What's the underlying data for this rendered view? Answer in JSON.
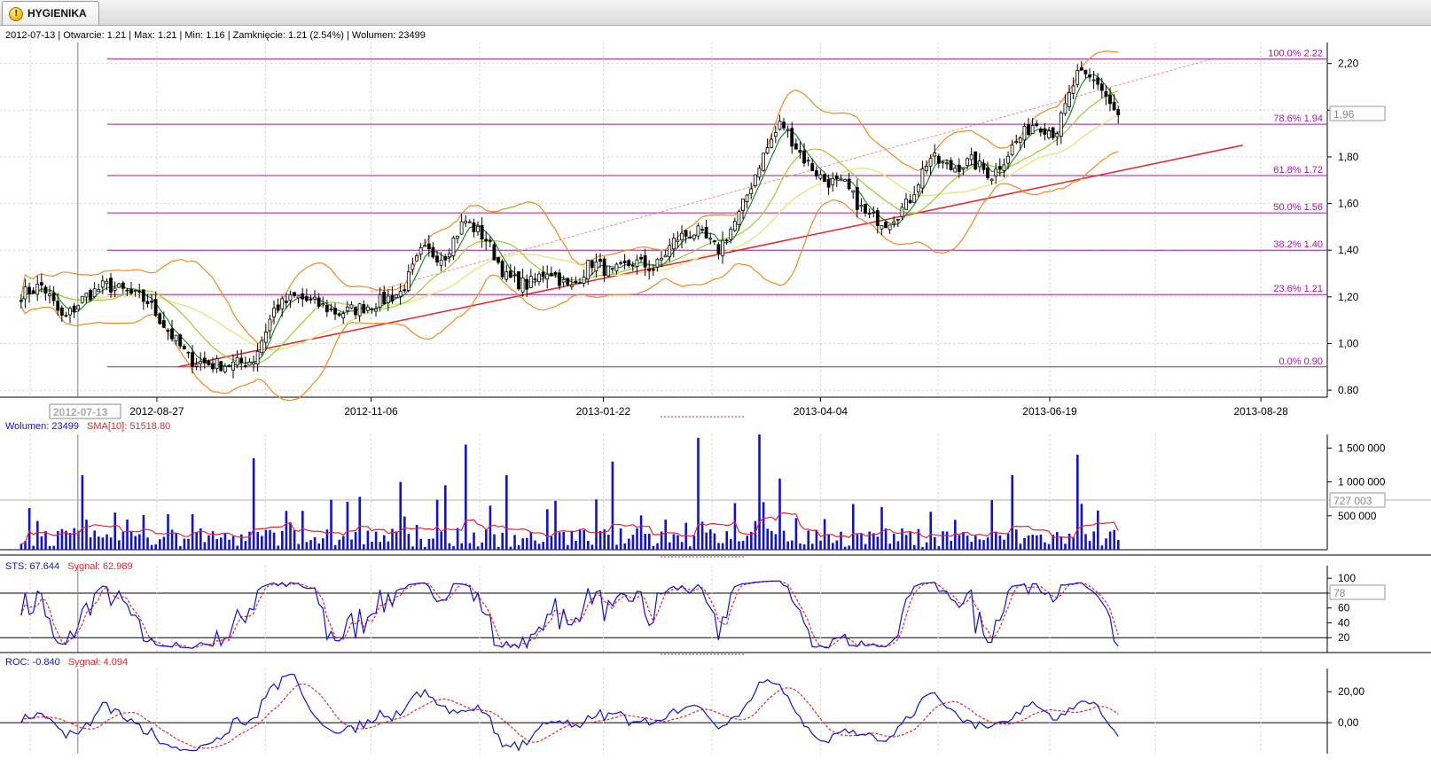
{
  "tab": {
    "label": "HYGIENIKA",
    "icon": "warning-icon",
    "icon_glyph": "!"
  },
  "info_bar": "2012-07-13 | Otwarcie: 1.21 | Max: 1.21 | Min: 1.16 | Zamknięcie: 1.21 (2.54%)  | Wolumen: 23499",
  "crosshair": {
    "date": "2012-07-13",
    "price_marker": "1,96",
    "volume_marker": "727 003",
    "sts_marker": "78"
  },
  "colors": {
    "background": "#ffffff",
    "grid": "#d0d0d0",
    "fib": "#a01aa0",
    "trend": "#e8232a",
    "bollinger": "#f08a1c",
    "ma_fast": "#1f8a1f",
    "ma_mid": "#9acd32",
    "ma_slow": "#e6e88a",
    "volume": "#1010d8",
    "signal": "#e8232a",
    "main_line": "#1010d8"
  },
  "chart_data": [
    {
      "type": "candlestick",
      "title": "HYGIENIKA",
      "x_tick_labels": [
        "2012-08-27",
        "2012-11-06",
        "2013-01-22",
        "2013-04-04",
        "2013-06-19",
        "2013-08-28"
      ],
      "y_tick_labels": [
        "0.80",
        "1,00",
        "1,20",
        "1,40",
        "1,60",
        "1,80",
        "2,00",
        "2,20"
      ],
      "y_ticks": [
        0.8,
        1.0,
        1.2,
        1.4,
        1.6,
        1.8,
        2.0,
        2.2
      ],
      "ylim": [
        0.77,
        2.29
      ],
      "fibonacci_levels": [
        {
          "label": "100.0% 2.22",
          "value": 2.22
        },
        {
          "label": "78.6% 1.94",
          "value": 1.94
        },
        {
          "label": "61.8% 1.72",
          "value": 1.72
        },
        {
          "label": "50.0% 1.56",
          "value": 1.56
        },
        {
          "label": "38.2% 1.40",
          "value": 1.4
        },
        {
          "label": "23.6% 1.21",
          "value": 1.21
        },
        {
          "label": "0.0% 0.90",
          "value": 0.9
        }
      ],
      "trend_line": {
        "from": {
          "x": "2012-09-03",
          "y": 0.9
        },
        "to": {
          "x": "2013-08-22",
          "y": 1.85
        }
      },
      "trend_line_dashed": {
        "from": {
          "x": "2012-11-06",
          "y": 1.22
        },
        "to": {
          "x": "2013-08-12",
          "y": 2.22
        }
      },
      "close_points": [
        {
          "x": "2012-07-13",
          "y": 1.21
        },
        {
          "x": "2012-07-20",
          "y": 1.25
        },
        {
          "x": "2012-07-27",
          "y": 1.1
        },
        {
          "x": "2012-08-03",
          "y": 1.2
        },
        {
          "x": "2012-08-10",
          "y": 1.25
        },
        {
          "x": "2012-08-17",
          "y": 1.22
        },
        {
          "x": "2012-08-24",
          "y": 1.18
        },
        {
          "x": "2012-08-31",
          "y": 1.05
        },
        {
          "x": "2012-09-07",
          "y": 0.93
        },
        {
          "x": "2012-09-14",
          "y": 0.91
        },
        {
          "x": "2012-09-21",
          "y": 0.91
        },
        {
          "x": "2012-09-28",
          "y": 0.93
        },
        {
          "x": "2012-10-05",
          "y": 1.15
        },
        {
          "x": "2012-10-12",
          "y": 1.2
        },
        {
          "x": "2012-10-19",
          "y": 1.17
        },
        {
          "x": "2012-10-26",
          "y": 1.13
        },
        {
          "x": "2012-11-02",
          "y": 1.15
        },
        {
          "x": "2012-11-09",
          "y": 1.18
        },
        {
          "x": "2012-11-16",
          "y": 1.22
        },
        {
          "x": "2012-11-23",
          "y": 1.4
        },
        {
          "x": "2012-11-30",
          "y": 1.37
        },
        {
          "x": "2012-12-07",
          "y": 1.53
        },
        {
          "x": "2012-12-14",
          "y": 1.45
        },
        {
          "x": "2012-12-21",
          "y": 1.28
        },
        {
          "x": "2012-12-28",
          "y": 1.25
        },
        {
          "x": "2013-01-04",
          "y": 1.32
        },
        {
          "x": "2013-01-11",
          "y": 1.23
        },
        {
          "x": "2013-01-18",
          "y": 1.35
        },
        {
          "x": "2013-01-25",
          "y": 1.3
        },
        {
          "x": "2013-02-01",
          "y": 1.35
        },
        {
          "x": "2013-02-08",
          "y": 1.32
        },
        {
          "x": "2013-02-15",
          "y": 1.45
        },
        {
          "x": "2013-02-22",
          "y": 1.48
        },
        {
          "x": "2013-03-01",
          "y": 1.4
        },
        {
          "x": "2013-03-08",
          "y": 1.55
        },
        {
          "x": "2013-03-15",
          "y": 1.78
        },
        {
          "x": "2013-03-22",
          "y": 1.95
        },
        {
          "x": "2013-03-29",
          "y": 1.8
        },
        {
          "x": "2013-04-05",
          "y": 1.7
        },
        {
          "x": "2013-04-12",
          "y": 1.68
        },
        {
          "x": "2013-04-19",
          "y": 1.55
        },
        {
          "x": "2013-04-26",
          "y": 1.52
        },
        {
          "x": "2013-05-03",
          "y": 1.6
        },
        {
          "x": "2013-05-10",
          "y": 1.8
        },
        {
          "x": "2013-05-17",
          "y": 1.75
        },
        {
          "x": "2013-05-24",
          "y": 1.78
        },
        {
          "x": "2013-05-31",
          "y": 1.72
        },
        {
          "x": "2013-06-07",
          "y": 1.85
        },
        {
          "x": "2013-06-14",
          "y": 1.95
        },
        {
          "x": "2013-06-21",
          "y": 1.9
        },
        {
          "x": "2013-06-28",
          "y": 2.15
        },
        {
          "x": "2013-07-05",
          "y": 2.12
        },
        {
          "x": "2013-07-12",
          "y": 1.96
        }
      ]
    },
    {
      "type": "bar",
      "title": "Wolumen",
      "series": [
        {
          "name": "Wolumen: 23499"
        },
        {
          "name": "SMA[10]: 51518.80"
        }
      ],
      "y_tick_labels": [
        "500 000",
        "1 000 000",
        "1 500 000"
      ],
      "y_ticks": [
        500000,
        1000000,
        1500000
      ],
      "ylim": [
        0,
        1700000
      ],
      "large_bars": [
        {
          "x": "2012-08-03",
          "y": 1100000
        },
        {
          "x": "2012-09-28",
          "y": 1350000
        },
        {
          "x": "2012-11-02",
          "y": 780000
        },
        {
          "x": "2012-11-16",
          "y": 1000000
        },
        {
          "x": "2012-11-30",
          "y": 950000
        },
        {
          "x": "2012-12-07",
          "y": 1550000
        },
        {
          "x": "2012-12-21",
          "y": 1100000
        },
        {
          "x": "2013-01-25",
          "y": 1300000
        },
        {
          "x": "2013-02-22",
          "y": 1650000
        },
        {
          "x": "2013-03-15",
          "y": 1700000
        },
        {
          "x": "2013-03-22",
          "y": 1050000
        },
        {
          "x": "2013-05-31",
          "y": 730000
        },
        {
          "x": "2013-06-07",
          "y": 1100000
        },
        {
          "x": "2013-06-28",
          "y": 1400000
        }
      ]
    },
    {
      "type": "line",
      "title": "STS",
      "series": [
        {
          "name": "STS: 67.644"
        },
        {
          "name": "Sygnał: 62.989"
        }
      ],
      "y_tick_labels": [
        "20",
        "40",
        "60",
        "80",
        "100"
      ],
      "y_ticks": [
        20,
        40,
        60,
        80,
        100
      ],
      "ylim": [
        0,
        105
      ],
      "reference_lines": [
        20,
        80
      ]
    },
    {
      "type": "line",
      "title": "ROC",
      "series": [
        {
          "name": "ROC: -0.840"
        },
        {
          "name": "Sygnał: 4.094"
        }
      ],
      "y_tick_labels": [
        "0,00",
        "20,00"
      ],
      "y_ticks": [
        0,
        20
      ],
      "ylim": [
        -20,
        35
      ],
      "reference_lines": [
        0
      ]
    }
  ]
}
